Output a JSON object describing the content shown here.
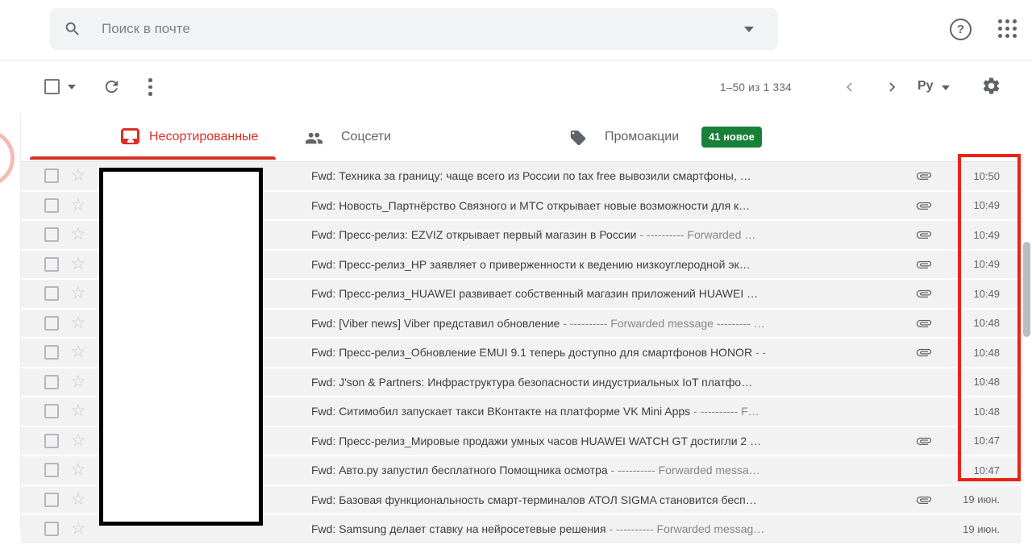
{
  "header": {
    "search": {
      "placeholder": "Поиск в почте"
    },
    "help_glyph": "?"
  },
  "toolbar": {
    "pagination": "1–50 из 1 334",
    "input_tools_label": "Ру"
  },
  "tabs": [
    {
      "label": "Несортированные",
      "active": true
    },
    {
      "label": "Соцсети",
      "active": false
    },
    {
      "label": "Промоакции",
      "active": false,
      "badge": "41 новое"
    }
  ],
  "list": {
    "star_glyph": "☆",
    "rows": [
      {
        "subject": "Fwd: Техника за границу: чаще всего из России по tax free вывозили смартфоны, …",
        "snippet": "",
        "has_attachment": true,
        "time": "10:50"
      },
      {
        "subject": "Fwd: Новость_Партнёрство Связного и МТС открывает новые возможности для к…",
        "snippet": "",
        "has_attachment": true,
        "time": "10:49"
      },
      {
        "subject": "Fwd: Пресс-релиз: EZVIZ открывает первый магазин в России",
        "snippet": " - ---------- Forwarded …",
        "has_attachment": true,
        "time": "10:49"
      },
      {
        "subject": "Fwd: Пресс-релиз_HP заявляет о приверженности к ведению низкоуглеродной эк…",
        "snippet": "",
        "has_attachment": true,
        "time": "10:49"
      },
      {
        "subject": "Fwd: Пресс-релиз_HUAWEI развивает собственный магазин приложений HUAWEI …",
        "snippet": "",
        "has_attachment": true,
        "time": "10:49"
      },
      {
        "subject": "Fwd: [Viber news] Viber представил обновление",
        "snippet": " - ---------- Forwarded message --------- …",
        "has_attachment": true,
        "time": "10:48"
      },
      {
        "subject": "Fwd: Пресс-релиз_Обновление EMUI 9.1 теперь доступно для смартфонов HONOR",
        "snippet": " - -",
        "has_attachment": true,
        "time": "10:48"
      },
      {
        "subject": "Fwd: J'son & Partners: Инфраструктура безопасности индустриальных IoT платфо…",
        "snippet": "",
        "has_attachment": false,
        "time": "10:48"
      },
      {
        "subject": "Fwd: Ситимобил запускает такси ВКонтакте на платформе VK Mini Apps",
        "snippet": " - ---------- F…",
        "has_attachment": false,
        "time": "10:48"
      },
      {
        "subject": "Fwd: Пресс-релиз_Мировые продажи умных часов HUAWEI WATCH GT достигли 2 …",
        "snippet": "",
        "has_attachment": true,
        "time": "10:47"
      },
      {
        "subject": "Fwd: Авто.ру запустил бесплатного Помощника осмотра",
        "snippet": " - ---------- Forwarded messa…",
        "has_attachment": false,
        "time": "10:47"
      },
      {
        "subject": "Fwd: Базовая функциональность смарт-терминалов АТОЛ SIGMA становится бесп…",
        "snippet": "",
        "has_attachment": true,
        "time": "19 июн."
      },
      {
        "subject": "Fwd: Samsung делает ставку на нейросетевые решения",
        "snippet": " - ---------- Forwarded messag…",
        "has_attachment": false,
        "time": "19 июн."
      }
    ]
  },
  "annotations": {
    "redaction_box_color": "#000000",
    "highlight_box_color": "#e62417",
    "arc_color": "#f3bcb6"
  },
  "colors": {
    "active_tab_red": "#d93025",
    "badge_green": "#188038",
    "row_background": "#f2f2f2",
    "icon_gray": "#5f6368"
  }
}
